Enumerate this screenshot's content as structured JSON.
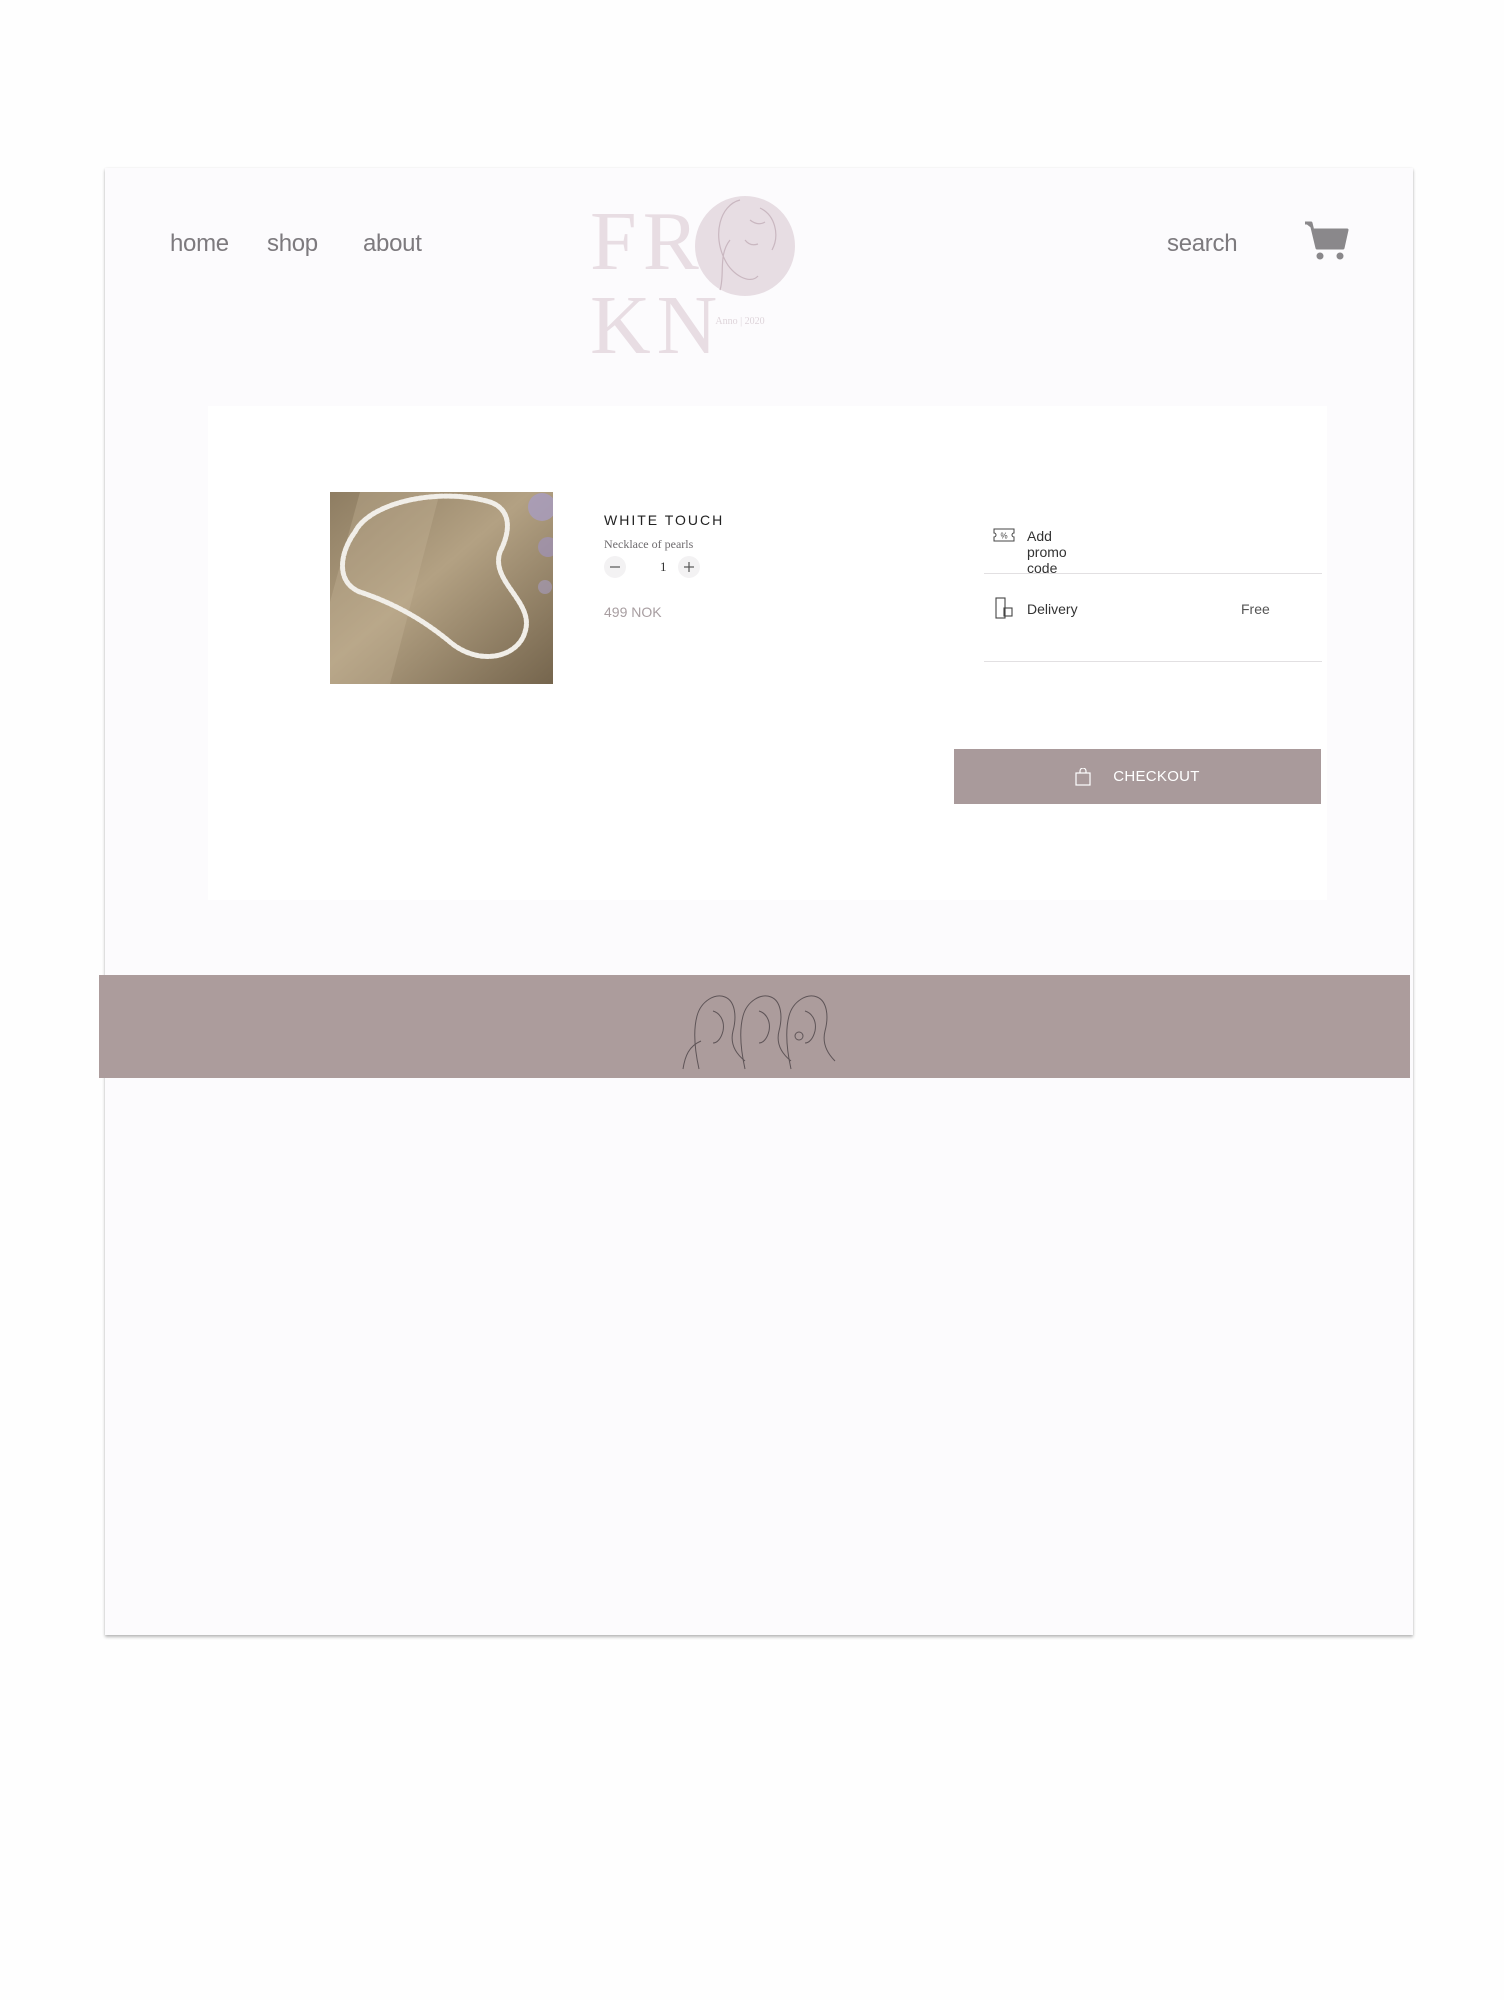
{
  "nav": {
    "home": "home",
    "shop": "shop",
    "about": "about",
    "search": "search"
  },
  "logo": {
    "text": "FR KN",
    "sub": "Anno | 2020"
  },
  "cart_item": {
    "title": "WHITE TOUCH",
    "subtitle": "Necklace of pearls",
    "quantity": "1",
    "price": "499 NOK"
  },
  "summary": {
    "promo_label": "Add promo code",
    "delivery_label": "Delivery",
    "delivery_value": "Free",
    "checkout_label": "CHECKOUT"
  },
  "icons": {
    "cart": "cart-icon",
    "promo": "ticket-percent-icon",
    "delivery": "delivery-box-icon",
    "checkout": "shopping-bag-icon",
    "minus": "minus-icon",
    "plus": "plus-icon"
  },
  "colors": {
    "accent": "#a99a9b",
    "footer": "#ac9c9c",
    "logo": "#e8dde3",
    "nav_text": "#7d7a7e"
  }
}
